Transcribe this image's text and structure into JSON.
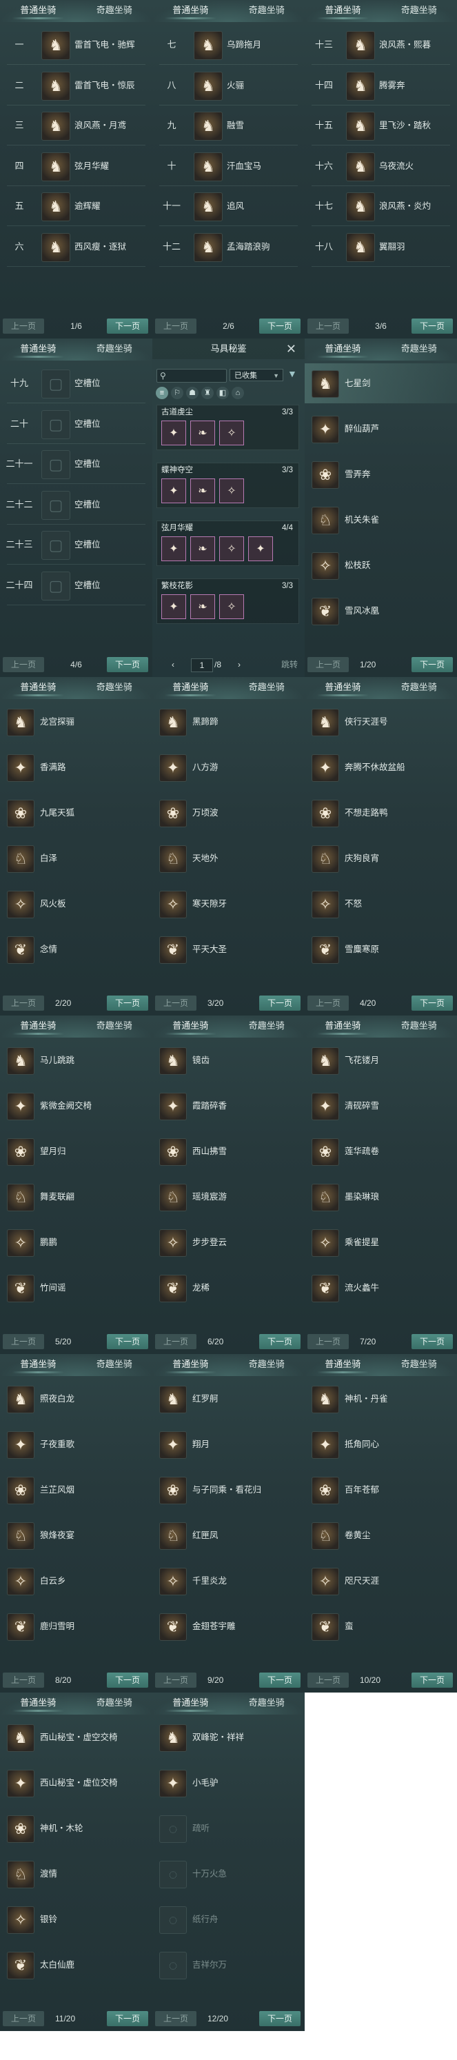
{
  "tabs": {
    "normal": "普通坐骑",
    "fancy": "奇趣坐骑"
  },
  "buttons": {
    "prev": "上一页",
    "next": "下一页"
  },
  "panelsA": [
    {
      "page": "1/6",
      "rows": [
        {
          "num": "一",
          "name": "雷首飞电・驰辉",
          "icon": "horse-icon"
        },
        {
          "num": "二",
          "name": "雷首飞电・惊辰",
          "icon": "horse-icon"
        },
        {
          "num": "三",
          "name": "浪风燕・月鸢",
          "icon": "horse-icon"
        },
        {
          "num": "四",
          "name": "弦月华耀",
          "icon": "horse-icon"
        },
        {
          "num": "五",
          "name": "逾辉耀",
          "icon": "horse-icon"
        },
        {
          "num": "六",
          "name": "西风瘦・逐狱",
          "icon": "horse-icon"
        }
      ]
    },
    {
      "page": "2/6",
      "rows": [
        {
          "num": "七",
          "name": "乌蹄拖月",
          "icon": "horse-icon"
        },
        {
          "num": "八",
          "name": "火骊",
          "icon": "horse-icon"
        },
        {
          "num": "九",
          "name": "融雪",
          "icon": "horse-icon"
        },
        {
          "num": "十",
          "name": "汗血宝马",
          "icon": "horse-icon"
        },
        {
          "num": "十一",
          "name": "追风",
          "icon": "horse-icon"
        },
        {
          "num": "十二",
          "name": "孟海踏浪驹",
          "icon": "horse-icon"
        }
      ]
    },
    {
      "page": "3/6",
      "rows": [
        {
          "num": "十三",
          "name": "浪风燕・熙暮",
          "icon": "horse-icon"
        },
        {
          "num": "十四",
          "name": "腾雾奔",
          "icon": "horse-icon"
        },
        {
          "num": "十五",
          "name": "里飞沙・踏秋",
          "icon": "horse-icon"
        },
        {
          "num": "十六",
          "name": "乌夜流火",
          "icon": "horse-icon"
        },
        {
          "num": "十七",
          "name": "浪风燕・炎灼",
          "icon": "horse-icon"
        },
        {
          "num": "十八",
          "name": "翼翮羽",
          "icon": "horse-icon"
        }
      ]
    }
  ],
  "panelEmpty": {
    "page": "4/6",
    "rows": [
      {
        "num": "十九",
        "name": "空槽位"
      },
      {
        "num": "二十",
        "name": "空槽位"
      },
      {
        "num": "二十一",
        "name": "空槽位"
      },
      {
        "num": "二十二",
        "name": "空槽位"
      },
      {
        "num": "二十三",
        "name": "空槽位"
      },
      {
        "num": "二十四",
        "name": "空槽位"
      }
    ]
  },
  "popup": {
    "title": "马具秘鉴",
    "filter_selected": "已收集",
    "sets": [
      {
        "name": "古道虔尘",
        "count": "3/3",
        "items": [
          "✦",
          "❧",
          "✧"
        ]
      },
      {
        "name": "蝶神夺空",
        "count": "3/3",
        "items": [
          "✦",
          "❧",
          "✧"
        ]
      },
      {
        "name": "弦月华耀",
        "count": "4/4",
        "items": [
          "✦",
          "❧",
          "✧",
          "✦"
        ]
      },
      {
        "name": "繁枝花影",
        "count": "3/3",
        "items": [
          "✦",
          "❧",
          "✧"
        ]
      }
    ],
    "page_value": "1",
    "page_total": "/8",
    "jump": "跳转"
  },
  "panelsB": [
    {
      "page": "1/20",
      "rows": [
        {
          "name": "七星剑"
        },
        {
          "name": "醉仙葫芦"
        },
        {
          "name": "雪弄奔"
        },
        {
          "name": "机关朱雀"
        },
        {
          "name": "松枝跃"
        },
        {
          "name": "雪风冰凰"
        }
      ]
    },
    {
      "page": "2/20",
      "rows": [
        {
          "name": "龙宫探骊"
        },
        {
          "name": "香满路"
        },
        {
          "name": "九尾天狐"
        },
        {
          "name": "白泽"
        },
        {
          "name": "风火板"
        },
        {
          "name": "念情"
        }
      ]
    },
    {
      "page": "3/20",
      "rows": [
        {
          "name": "黑蹄蹄"
        },
        {
          "name": "八方游"
        },
        {
          "name": "万顷波"
        },
        {
          "name": "天地外"
        },
        {
          "name": "寒天隙牙"
        },
        {
          "name": "平天大圣"
        }
      ]
    },
    {
      "page": "4/20",
      "rows": [
        {
          "name": "侠行天涯号"
        },
        {
          "name": "奔腾不休故盆船"
        },
        {
          "name": "不想走路鸭"
        },
        {
          "name": "庆狗良宵"
        },
        {
          "name": "不怒"
        },
        {
          "name": "雪麋寒原"
        }
      ]
    },
    {
      "page": "5/20",
      "rows": [
        {
          "name": "马儿跳跳"
        },
        {
          "name": "紫微金阙交椅"
        },
        {
          "name": "望月归"
        },
        {
          "name": "舞麦联翩"
        },
        {
          "name": "鹏鹏"
        },
        {
          "name": "竹间谣"
        }
      ]
    },
    {
      "page": "6/20",
      "rows": [
        {
          "name": "镜齿"
        },
        {
          "name": "霞踏碎香"
        },
        {
          "name": "西山拂雪"
        },
        {
          "name": "瑶境宸游"
        },
        {
          "name": "步步登云"
        },
        {
          "name": "龙稀"
        }
      ]
    },
    {
      "page": "7/20",
      "rows": [
        {
          "name": "飞花镂月"
        },
        {
          "name": "清砚碎雪"
        },
        {
          "name": "莲华疏卷"
        },
        {
          "name": "墨染琳琅"
        },
        {
          "name": "乘雀提星"
        },
        {
          "name": "流火蠡牛"
        }
      ]
    },
    {
      "page": "8/20",
      "rows": [
        {
          "name": "照夜白龙"
        },
        {
          "name": "子夜重歌"
        },
        {
          "name": "兰芷风烟"
        },
        {
          "name": "狼烽夜宴"
        },
        {
          "name": "白云乡"
        },
        {
          "name": "鹿归雪明"
        }
      ]
    },
    {
      "page": "9/20",
      "rows": [
        {
          "name": "红罗舸"
        },
        {
          "name": "翔月"
        },
        {
          "name": "与子同乘・看花归"
        },
        {
          "name": "红匣凤"
        },
        {
          "name": "千里炎龙"
        },
        {
          "name": "金翅苍宇雕"
        }
      ]
    },
    {
      "page": "10/20",
      "rows": [
        {
          "name": "神机・丹雀"
        },
        {
          "name": "抵角同心"
        },
        {
          "name": "百年苍郁"
        },
        {
          "name": "卷黄尘"
        },
        {
          "name": "咫尺天涯"
        },
        {
          "name": "蛮"
        }
      ]
    },
    {
      "page": "11/20",
      "rows": [
        {
          "name": "西山秘宝・虚空交椅"
        },
        {
          "name": "西山秘宝・虚位交椅"
        },
        {
          "name": "神机・木轮"
        },
        {
          "name": "渡情"
        },
        {
          "name": "银铃"
        },
        {
          "name": "太白仙鹿"
        }
      ]
    },
    {
      "page": "12/20",
      "rows": [
        {
          "name": "双峰驼・祥祥"
        },
        {
          "name": "小毛驴"
        },
        {
          "name": "疏听",
          "dim": true
        },
        {
          "name": "十万火急",
          "dim": true
        },
        {
          "name": "纸行舟",
          "dim": true
        },
        {
          "name": "吉祥尔万",
          "dim": true
        }
      ]
    }
  ]
}
